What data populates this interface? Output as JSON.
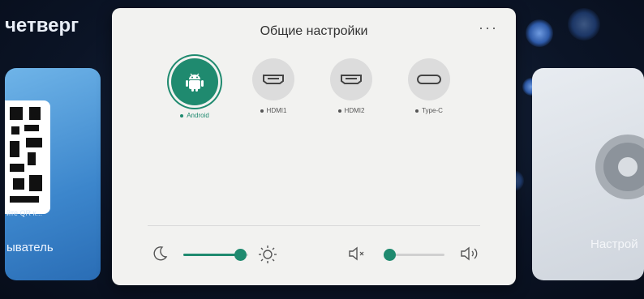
{
  "background": {
    "day_label": "четверг",
    "left_card": {
      "qr_hint": "йте QR к...",
      "label": "ыватель"
    },
    "right_card": {
      "label": "Настрой"
    }
  },
  "panel": {
    "title": "Общие настройки",
    "more_label": "···",
    "sources": [
      {
        "label": "Android",
        "icon": "android-icon",
        "active": true
      },
      {
        "label": "HDMI1",
        "icon": "hdmi-port-icon",
        "active": false
      },
      {
        "label": "HDMI2",
        "icon": "hdmi-port-icon",
        "active": false
      },
      {
        "label": "Type-C",
        "icon": "usb-c-port-icon",
        "active": false
      }
    ],
    "brightness": {
      "level": 0.88,
      "min_icon": "moon-icon",
      "max_icon": "sun-icon"
    },
    "volume": {
      "level": 0.05,
      "min_icon": "speaker-mute-icon",
      "max_icon": "speaker-loud-icon"
    }
  },
  "colors": {
    "accent": "#1f8a6f",
    "panel": "#f2f2f0"
  }
}
